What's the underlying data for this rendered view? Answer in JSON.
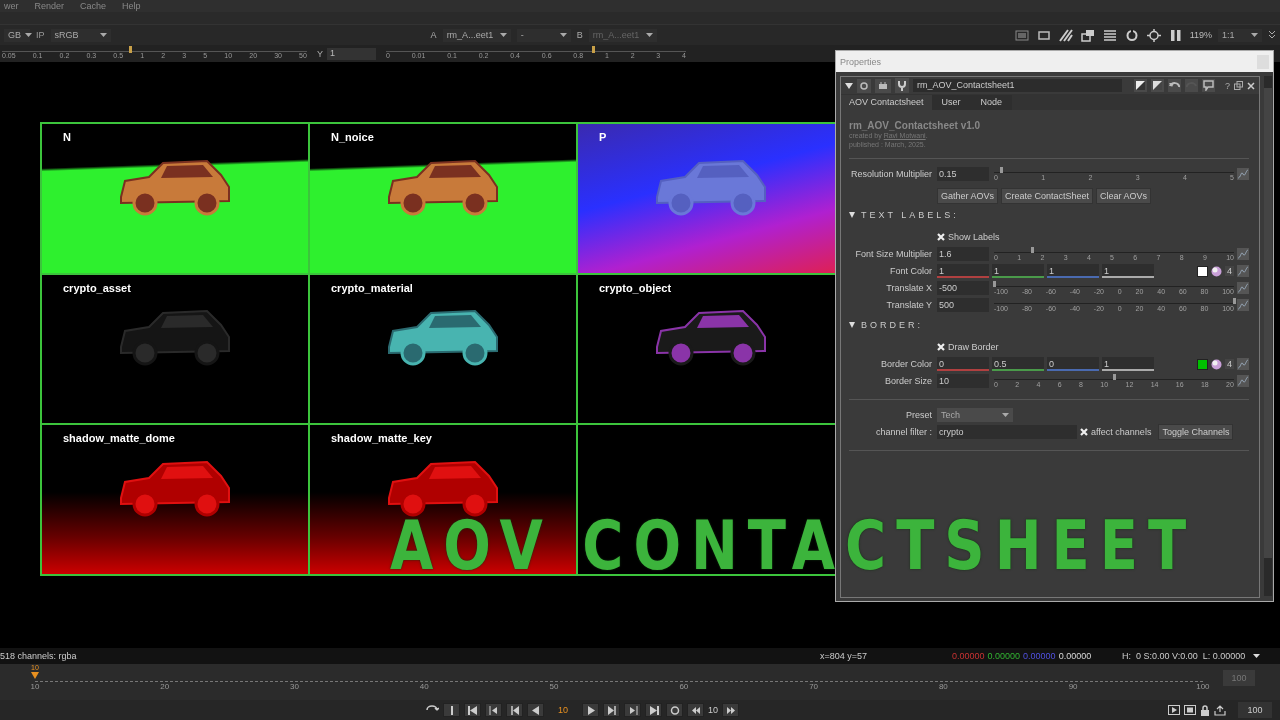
{
  "menu_bar": {
    "items": [
      "wer",
      "Render",
      "Cache",
      "Help"
    ]
  },
  "viewer_toolbar": {
    "lut_left": "GB",
    "ip": "IP",
    "lut": "sRGB",
    "input_a": {
      "letter": "A",
      "node": "rm_A...eet1"
    },
    "wipe_mode": "-",
    "input_b": {
      "letter": "B",
      "node": "rm_A...eet1"
    },
    "zoom": "119%",
    "proxy": "1:1"
  },
  "viewer_ruler": {
    "gain": {
      "ticks": [
        "0.05",
        "0.1",
        "0.2",
        "0.3",
        "0.5",
        "1",
        "2",
        "3",
        "5",
        "10",
        "20",
        "30",
        "50"
      ],
      "level": 0.42
    },
    "y_label": "Y",
    "y_value": "1",
    "gamma": {
      "ticks": [
        "0",
        "0.01",
        "0.1",
        "0.2",
        "0.4",
        "0.6",
        "0.8",
        "1",
        "2",
        "3",
        "4"
      ],
      "level": 0.69
    }
  },
  "contact_sheet": {
    "cells": [
      {
        "label": "N",
        "kind": "green"
      },
      {
        "label": "N_noice",
        "kind": "green"
      },
      {
        "label": "P",
        "kind": "position"
      },
      {
        "label": "crypto_asset",
        "kind": "dark"
      },
      {
        "label": "crypto_material",
        "kind": "teal"
      },
      {
        "label": "crypto_object",
        "kind": "purple"
      },
      {
        "label": "shadow_matte_dome",
        "kind": "red"
      },
      {
        "label": "shadow_matte_key",
        "kind": "red"
      },
      {
        "kind": "empty"
      }
    ]
  },
  "video_title": "AOV CONTACTSHEET",
  "properties": {
    "title": "Properties",
    "node_name": "rm_AOV_Contactsheet1",
    "help": "?",
    "tabs": [
      {
        "label": "AOV Contactsheet",
        "selected": true
      },
      {
        "label": "User",
        "selected": false
      },
      {
        "label": "Node",
        "selected": false
      }
    ],
    "header": {
      "title": "rm_AOV_Contactsheet v1.0",
      "credit": "created by ",
      "author": "Ravi Motwani",
      "credit_end": ".",
      "published": "published : March, 2025."
    },
    "knobs": [
      {
        "kind": "slider",
        "label": "Resolution Multiplier",
        "value": "0.15",
        "level": 0.03,
        "ticks": [
          "0",
          "1",
          "2",
          "3",
          "4",
          "5"
        ]
      },
      {
        "kind": "buttons",
        "buttons": [
          "Gather AOVs",
          "Create ContactSheet",
          "Clear AOVs"
        ]
      },
      {
        "kind": "section",
        "label": "TEXT LABELS:",
        "expanded": true
      },
      {
        "kind": "checkbox",
        "label": "Show Labels",
        "checked": true
      },
      {
        "kind": "slider",
        "label": "Font Size Multiplier",
        "value": "1.6",
        "level": 0.16,
        "ticks": [
          "0",
          "1",
          "2",
          "3",
          "4",
          "5",
          "6",
          "7",
          "8",
          "9",
          "10"
        ]
      },
      {
        "kind": "color",
        "label": "Font Color",
        "values": [
          "1",
          "1",
          "1",
          "1"
        ],
        "color": "#ffffff",
        "channels": "4"
      },
      {
        "kind": "slider",
        "label": "Translate X",
        "value": "-500",
        "level": 0,
        "ticks": [
          "-100",
          "-80",
          "-60",
          "-40",
          "-20",
          "0",
          "20",
          "40",
          "60",
          "80",
          "100"
        ]
      },
      {
        "kind": "slider",
        "label": "Translate Y",
        "value": "500",
        "level": 1,
        "ticks": [
          "-100",
          "-80",
          "-60",
          "-40",
          "-20",
          "0",
          "20",
          "40",
          "60",
          "80",
          "100"
        ]
      },
      {
        "kind": "section",
        "label": "BORDER:",
        "expanded": true
      },
      {
        "kind": "checkbox",
        "label": "Draw Border",
        "checked": true
      },
      {
        "kind": "color",
        "label": "Border Color",
        "values": [
          "0",
          "0.5",
          "0",
          "1"
        ],
        "color": "#00c000",
        "channels": "4"
      },
      {
        "kind": "slider",
        "label": "Border Size",
        "value": "10",
        "level": 0.5,
        "ticks": [
          "0",
          "2",
          "4",
          "6",
          "8",
          "10",
          "12",
          "14",
          "16",
          "18",
          "20"
        ]
      },
      {
        "kind": "divider"
      },
      {
        "kind": "dropdown",
        "label": "Preset",
        "value": "Tech"
      },
      {
        "kind": "filter",
        "label": "channel filter :",
        "value": "crypto",
        "check_label": "affect channels",
        "checked": true,
        "button": "Toggle Channels"
      },
      {
        "kind": "divider"
      }
    ]
  },
  "status_bar": {
    "channels": "518 channels: rgba",
    "coords": "x=804 y=57",
    "pixel": [
      {
        "value": "0.00000",
        "kind": "red"
      },
      {
        "value": "0.00000",
        "kind": "green"
      },
      {
        "value": "0.00000",
        "kind": "blue"
      },
      {
        "value": "0.00000",
        "kind": "alpha"
      }
    ],
    "hsvl": "H:  0 S:0.00 V:0.00  L: 0.00000"
  },
  "timeline": {
    "ticks": [
      "10",
      "20",
      "30",
      "40",
      "50",
      "60",
      "70",
      "80",
      "90",
      "100"
    ],
    "playhead_label": "10",
    "level": 0,
    "in_field": "100"
  },
  "playback": {
    "frame": "10",
    "step": "10",
    "end": "100"
  }
}
